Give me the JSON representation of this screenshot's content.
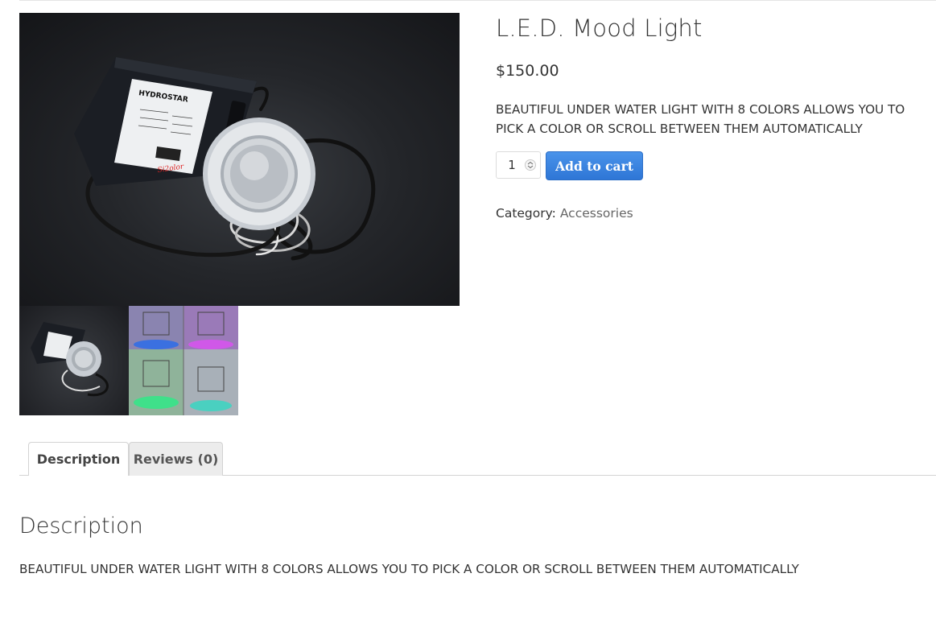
{
  "product": {
    "title": "L.E.D. Mood Light",
    "price": "$150.00",
    "short_description": "BEAUTIFUL UNDER WATER LIGHT WITH 8 COLORS ALLOWS YOU TO PICK A COLOR OR SCROLL BETWEEN THEM AUTOMATICALLY",
    "quantity": "1",
    "add_to_cart_label": "Add to cart",
    "category_label": "Category:",
    "category_value": "Accessories"
  },
  "device_label": {
    "brand": "HYDROSTAR",
    "signature": "Si2olor"
  },
  "tabs": [
    {
      "label": "Description"
    },
    {
      "label": "Reviews (0)"
    }
  ],
  "description_panel": {
    "title": "Description",
    "text": "BEAUTIFUL UNDER WATER LIGHT WITH 8 COLORS ALLOWS YOU TO PICK A COLOR OR SCROLL BETWEEN THEM AUTOMATICALLY"
  },
  "colors": {
    "button": "#2e76d6",
    "link": "#666666",
    "text": "#333333"
  }
}
